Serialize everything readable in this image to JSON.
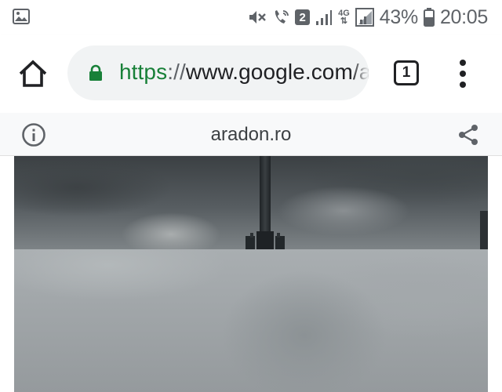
{
  "status_bar": {
    "left_icon": "gallery-icon",
    "icons": [
      "mute-icon",
      "wifi-calling-icon",
      "sim-2-icon",
      "signal-icon",
      "4g-icon",
      "signal-icon",
      "battery-icon"
    ],
    "sim_label": "2",
    "network_label_top": "4G",
    "battery_percent": "43%",
    "time": "20:05"
  },
  "toolbar": {
    "home_icon": "home-icon",
    "lock_icon": "lock-icon",
    "url_scheme": "https",
    "url_separator": "://",
    "url_host": "www.google.com/a",
    "tab_count": "1",
    "menu_icon": "more-vertical-icon",
    "colors": {
      "secure": "#188038",
      "omnibox_bg": "#f1f3f4"
    }
  },
  "info_bar": {
    "info_icon": "info-icon",
    "site": "aradon.ro",
    "share_icon": "share-icon"
  },
  "content": {
    "image_description": "cloudy-sky-with-light-pole"
  }
}
